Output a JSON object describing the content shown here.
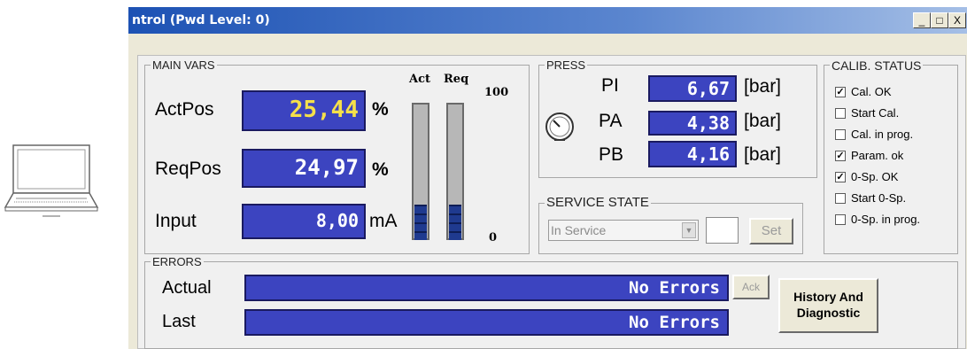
{
  "window": {
    "title": "ntrol (Pwd Level: 0)",
    "min_btn": "_",
    "max_btn": "□",
    "close_btn": "X"
  },
  "main_vars": {
    "legend": "MAIN VARS",
    "act_header": "Act",
    "req_header": "Req",
    "scale_max": "100",
    "scale_min": "0",
    "actpos": {
      "label": "ActPos",
      "value": "25,44",
      "unit": "%"
    },
    "reqpos": {
      "label": "ReqPos",
      "value": "24,97",
      "unit": "%"
    },
    "input": {
      "label": "Input",
      "value": "8,00",
      "unit": "mA"
    },
    "act_bar_level": 25.44,
    "req_bar_level": 24.97
  },
  "press": {
    "legend": "PRESS",
    "rows": [
      {
        "label": "PI",
        "value": "6,67",
        "unit": "[bar]"
      },
      {
        "label": "PA",
        "value": "4,38",
        "unit": "[bar]"
      },
      {
        "label": "PB",
        "value": "4,16",
        "unit": "[bar]"
      }
    ]
  },
  "service_state": {
    "legend": "SERVICE STATE",
    "selected": "In Service",
    "code": "",
    "set_label": "Set"
  },
  "calib": {
    "legend": "CALIB. STATUS",
    "items": [
      {
        "label": "Cal. OK",
        "checked": true
      },
      {
        "label": "Start Cal.",
        "checked": false
      },
      {
        "label": "Cal. in prog.",
        "checked": false
      },
      {
        "label": "Param. ok",
        "checked": true
      },
      {
        "label": "0-Sp. OK",
        "checked": true
      },
      {
        "label": "Start 0-Sp.",
        "checked": false
      },
      {
        "label": "0-Sp. in prog.",
        "checked": false
      }
    ]
  },
  "errors": {
    "legend": "ERRORS",
    "actual_label": "Actual",
    "actual_value": "No Errors",
    "last_label": "Last",
    "last_value": "No Errors",
    "ack_label": "Ack",
    "history_label": "History And Diagnostic"
  },
  "colors": {
    "display_bg": "#3c44c0",
    "actpos_text": "#f5e04a",
    "titlebar": "#1d52b4"
  }
}
